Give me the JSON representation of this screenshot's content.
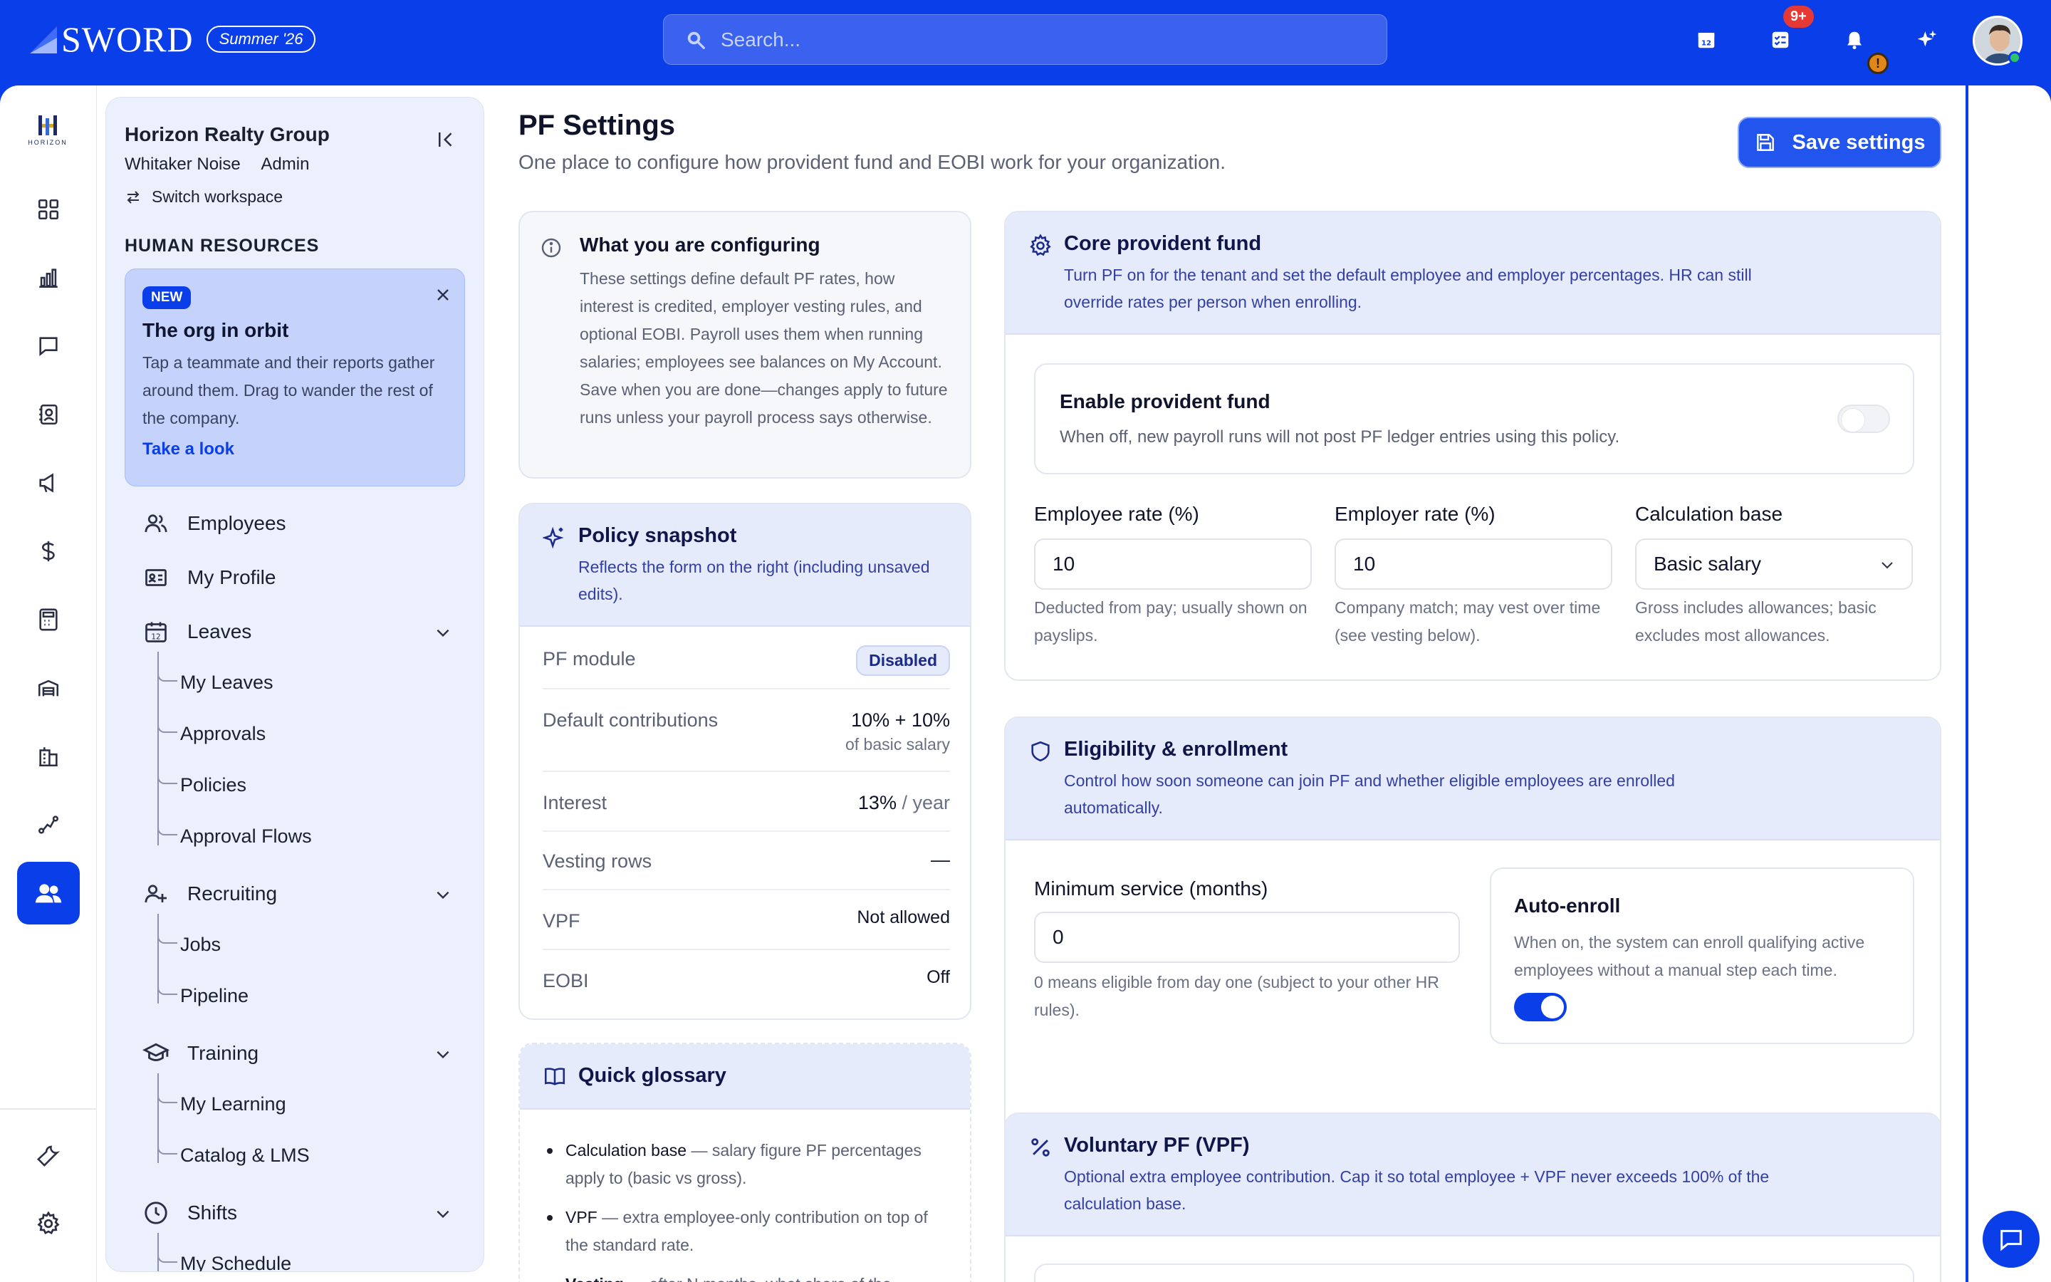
{
  "brand": {
    "name": "SWORD",
    "season": "Summer '26"
  },
  "search": {
    "placeholder": "Search..."
  },
  "topbar": {
    "notification_count": "9+",
    "warning_mark": "!"
  },
  "workspace": {
    "org_name": "Horizon Realty Group",
    "user_name": "Whitaker Noise",
    "role": "Admin",
    "switch_label": "Switch workspace",
    "logo_text": "HORIZON"
  },
  "sidenav": {
    "section_label": "HUMAN RESOURCES",
    "promo": {
      "badge": "NEW",
      "title": "The org in orbit",
      "body": "Tap a teammate and their reports gather around them. Drag to wander the rest of the company.",
      "link": "Take a look"
    },
    "items": [
      {
        "label": "Employees",
        "icon": "users-icon"
      },
      {
        "label": "My Profile",
        "icon": "id-card-icon"
      },
      {
        "label": "Leaves",
        "icon": "calendar-icon",
        "children": [
          "My Leaves",
          "Approvals",
          "Policies",
          "Approval Flows"
        ]
      },
      {
        "label": "Recruiting",
        "icon": "user-plus-icon",
        "children": [
          "Jobs",
          "Pipeline"
        ]
      },
      {
        "label": "Training",
        "icon": "graduation-cap-icon",
        "children": [
          "My Learning",
          "Catalog & LMS"
        ]
      },
      {
        "label": "Shifts",
        "icon": "clock-icon",
        "children": [
          "My Schedule"
        ]
      }
    ]
  },
  "page": {
    "title": "PF Settings",
    "subtitle": "One place to configure how provident fund and EOBI work for your organization.",
    "save_label": "Save settings"
  },
  "info_card": {
    "title": "What you are configuring",
    "body": "These settings define default PF rates, how interest is credited, employer vesting rules, and optional EOBI. Payroll uses them when running salaries; employees see balances on My Account. Save when you are done—changes apply to future runs unless your payroll process says otherwise."
  },
  "snapshot": {
    "title": "Policy snapshot",
    "subtitle": "Reflects the form on the right (including unsaved edits).",
    "rows": {
      "pf_module": {
        "label": "PF module",
        "value": "Disabled"
      },
      "contributions": {
        "label": "Default contributions",
        "value": "10% + 10%",
        "note": "of basic salary"
      },
      "interest": {
        "label": "Interest",
        "value": "13%",
        "unit": "/ year"
      },
      "vesting": {
        "label": "Vesting rows",
        "value": "—"
      },
      "vpf": {
        "label": "VPF",
        "value": "Not allowed"
      },
      "eobi": {
        "label": "EOBI",
        "value": "Off"
      }
    }
  },
  "glossary": {
    "title": "Quick glossary",
    "items": [
      {
        "term": "Calculation base",
        "def": " — salary figure PF percentages apply to (basic vs gross)."
      },
      {
        "term": "VPF",
        "def": " — extra employee-only contribution on top of the standard rate."
      },
      {
        "term": "Vesting",
        "def": " — after N months, what share of the"
      }
    ]
  },
  "core": {
    "title": "Core provident fund",
    "subtitle": "Turn PF on for the tenant and set the default employee and employer percentages. HR can still override rates per person when enrolling.",
    "enable": {
      "title": "Enable provident fund",
      "subtitle": "When off, new payroll runs will not post PF ledger entries using this policy.",
      "enabled": false
    },
    "employee_rate": {
      "label": "Employee rate (%)",
      "value": "10",
      "help": "Deducted from pay; usually shown on payslips."
    },
    "employer_rate": {
      "label": "Employer rate (%)",
      "value": "10",
      "help": "Company match; may vest over time (see vesting below)."
    },
    "calc_base": {
      "label": "Calculation base",
      "value": "Basic salary",
      "help": "Gross includes allowances; basic excludes most allowances."
    }
  },
  "eligibility": {
    "title": "Eligibility & enrollment",
    "subtitle": "Control how soon someone can join PF and whether eligible employees are enrolled automatically.",
    "min_service": {
      "label": "Minimum service (months)",
      "value": "0",
      "help": "0 means eligible from day one (subject to your other HR rules)."
    },
    "auto_enroll": {
      "title": "Auto-enroll",
      "subtitle": "When on, the system can enroll qualifying active employees without a manual step each time.",
      "enabled": true
    }
  },
  "vpf": {
    "title": "Voluntary PF (VPF)",
    "subtitle": "Optional extra employee contribution. Cap it so total employee + VPF never exceeds 100% of the calculation base."
  },
  "colors": {
    "brand": "#0a3ee8",
    "nav_bg": "#ecf0fc",
    "card_head": "#e6ebfc",
    "badge_red": "#e53935"
  }
}
